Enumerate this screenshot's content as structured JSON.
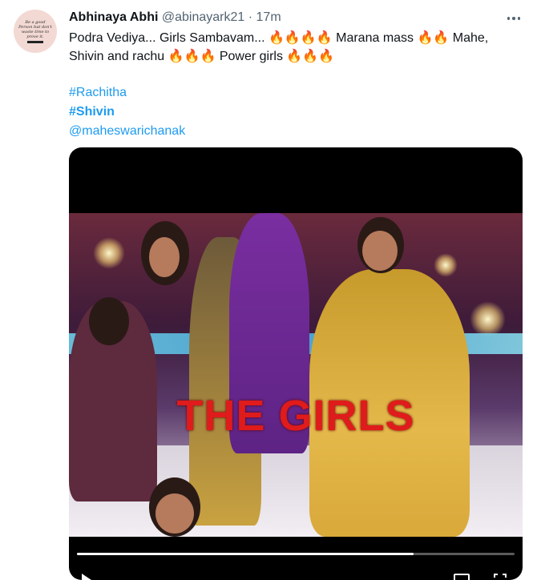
{
  "tweet": {
    "author_name": "Abhinaya Abhi",
    "author_handle": "@abinayark21",
    "separator": "·",
    "time": "17m",
    "avatar_text": "Be a good Person but don't waste time to prove it.",
    "text_line1": "Podra Vediya... Girls Sambavam... 🔥🔥🔥🔥 Marana mass  🔥🔥 Mahe,",
    "text_line2": "Shivin and rachu 🔥🔥🔥 Power girls 🔥🔥🔥",
    "links": [
      "#Rachitha",
      "#Shivin",
      "@maheswarichanak"
    ]
  },
  "video": {
    "caption": "THE GIRLS",
    "progress": 0.77,
    "current_time": "",
    "duration": ""
  },
  "colors": {
    "link": "#1d9bf0",
    "caption": "#e01b1b",
    "secondary_text": "#536471"
  }
}
